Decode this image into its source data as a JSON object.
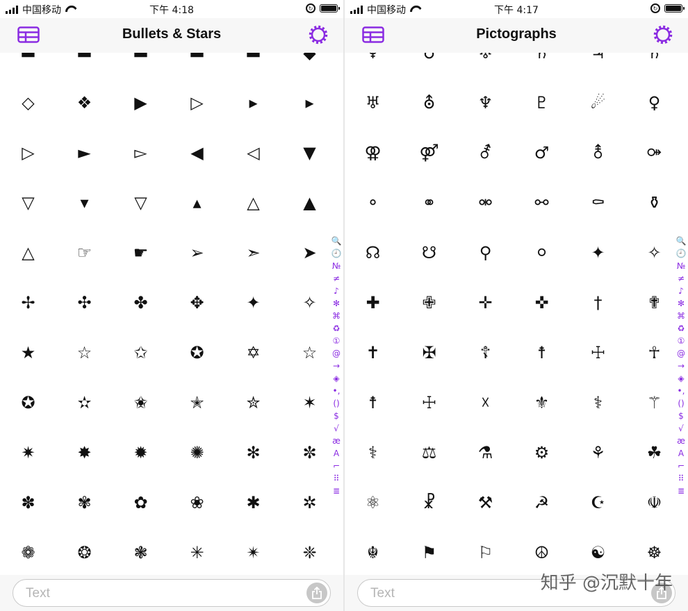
{
  "colors": {
    "accent": "#8a2be2",
    "navbar_bg": "#f7f7f7",
    "inputbar_bg": "#f7f7f7",
    "placeholder": "#b5b5b5"
  },
  "watermark": "知乎 @沉默十年",
  "screens": [
    {
      "carrier": "中国移动",
      "time": "下午 4:18",
      "title": "Bullets & Stars",
      "input": {
        "placeholder": "Text",
        "value": ""
      },
      "glyphs": [
        "▬",
        "▬",
        "▬",
        "▬",
        "▬",
        "◆",
        "◇",
        "❖",
        "▶",
        "▷",
        "▸",
        "▸",
        "▷",
        "►",
        "▻",
        "◀",
        "◁",
        "▼",
        "▽",
        "▾",
        "▽",
        "▴",
        "△",
        "▲",
        "△",
        "☞",
        "☛",
        "➢",
        "➣",
        "➤",
        "✢",
        "✣",
        "✤",
        "✥",
        "✦",
        "✧",
        "★",
        "☆",
        "✩",
        "✪",
        "✡",
        "☆",
        "✪",
        "✫",
        "✬",
        "✭",
        "✮",
        "✶",
        "✷",
        "✸",
        "✹",
        "✺",
        "✻",
        "✼",
        "✽",
        "✾",
        "✿",
        "❀",
        "✱",
        "✲",
        "❁",
        "❂",
        "❃",
        "✳",
        "✴",
        "❈"
      ],
      "index": [
        "🔍",
        "🕘",
        "№",
        "≠",
        "♪",
        "✻",
        "⌘",
        "♻",
        "①",
        "@",
        "→",
        "◈",
        "•,",
        "()",
        "$",
        "√",
        "æ",
        "A",
        "⌐",
        "⠿",
        "≣"
      ]
    },
    {
      "carrier": "中国移动",
      "time": "下午 4:17",
      "title": "Pictographs",
      "input": {
        "placeholder": "Text",
        "value": ""
      },
      "glyphs": [
        "♆",
        "♁",
        "♅",
        "♄",
        "♃",
        "♄",
        "♅",
        "⛢",
        "♆",
        "♇",
        "☄",
        "♀",
        "⚢",
        "⚤",
        "⚦",
        "♂",
        "⚨",
        "⚩",
        "⚬",
        "⚭",
        "⚮",
        "⚯",
        "⚰",
        "⚱",
        "☊",
        "☋",
        "⚲",
        "⚪",
        "✦",
        "✧",
        "✚",
        "✙",
        "✛",
        "✜",
        "†",
        "✟",
        "✝",
        "✠",
        "☦",
        "☨",
        "☩",
        "☥",
        "☨",
        "☩",
        "☓",
        "⚜",
        "⚕",
        "⚚",
        "⚕",
        "⚖",
        "⚗",
        "⚙",
        "⚘",
        "☘",
        "⚛",
        "☧",
        "⚒",
        "☭",
        "☪",
        "☫",
        "☬",
        "⚑",
        "⚐",
        "☮",
        "☯",
        "☸"
      ],
      "index": [
        "🔍",
        "🕘",
        "№",
        "≠",
        "♪",
        "✻",
        "⌘",
        "♻",
        "①",
        "@",
        "→",
        "◈",
        "•,",
        "()",
        "$",
        "√",
        "æ",
        "A",
        "⌐",
        "⠿",
        "≣"
      ]
    }
  ]
}
